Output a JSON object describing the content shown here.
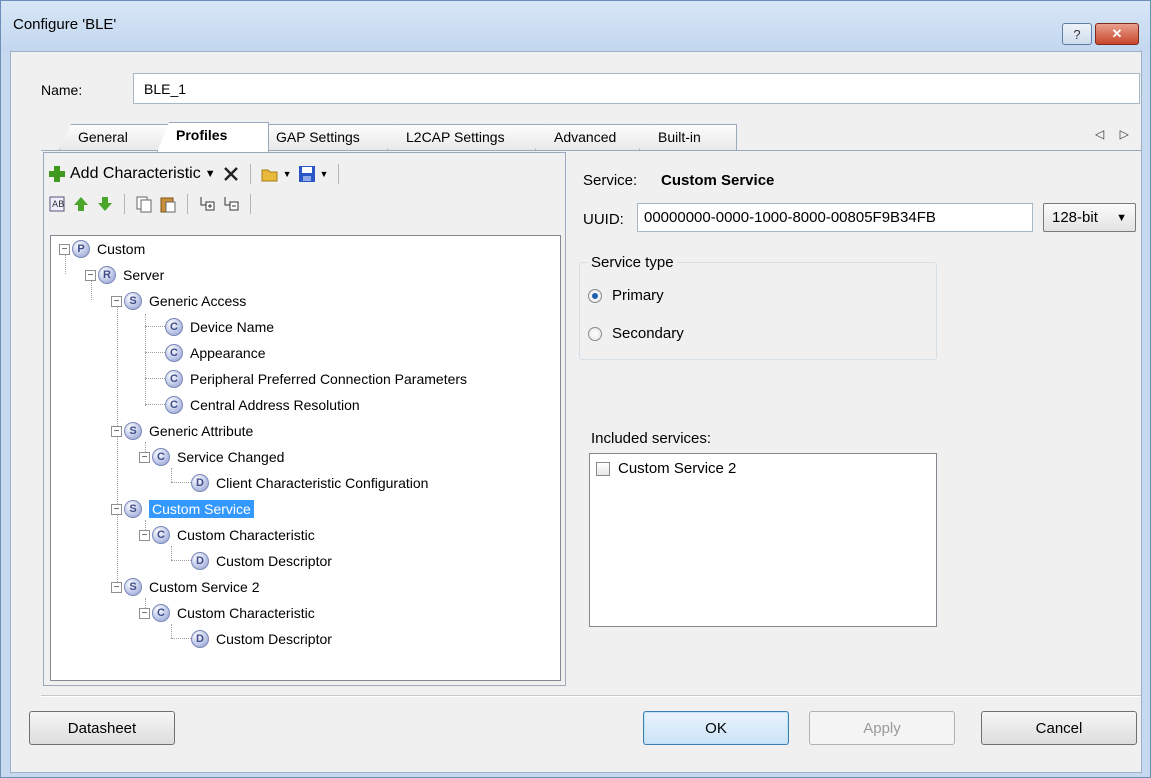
{
  "window": {
    "title": "Configure 'BLE'",
    "help_label": "?",
    "close_label": "✕"
  },
  "name": {
    "label": "Name:",
    "value": "BLE_1"
  },
  "tabs": [
    {
      "label": "General",
      "active": false
    },
    {
      "label": "Profiles",
      "active": true
    },
    {
      "label": "GAP Settings",
      "active": false
    },
    {
      "label": "L2CAP Settings",
      "active": false
    },
    {
      "label": "Advanced",
      "active": false
    },
    {
      "label": "Built-in",
      "active": false
    }
  ],
  "tab_scroll": "◁ ▷",
  "toolbar": {
    "add_characteristic_label": "Add Characteristic",
    "icons": [
      "add-icon",
      "dropdown-arrow-icon",
      "delete-icon",
      "open-folder-icon",
      "save-icon",
      "sort-icon",
      "move-up-icon",
      "move-down-icon",
      "copy-icon",
      "paste-icon",
      "expand-all-icon",
      "collapse-all-icon"
    ]
  },
  "tree": [
    {
      "badge": "P",
      "label": "Custom"
    },
    {
      "badge": "R",
      "label": "Server"
    },
    {
      "badge": "S",
      "label": "Generic Access"
    },
    {
      "badge": "C",
      "label": "Device Name"
    },
    {
      "badge": "C",
      "label": "Appearance"
    },
    {
      "badge": "C",
      "label": "Peripheral Preferred Connection Parameters"
    },
    {
      "badge": "C",
      "label": "Central Address Resolution"
    },
    {
      "badge": "S",
      "label": "Generic Attribute"
    },
    {
      "badge": "C",
      "label": "Service Changed"
    },
    {
      "badge": "D",
      "label": "Client Characteristic Configuration"
    },
    {
      "badge": "S",
      "label": "Custom Service",
      "selected": true
    },
    {
      "badge": "C",
      "label": "Custom Characteristic"
    },
    {
      "badge": "D",
      "label": "Custom Descriptor"
    },
    {
      "badge": "S",
      "label": "Custom Service 2"
    },
    {
      "badge": "C",
      "label": "Custom Characteristic"
    },
    {
      "badge": "D",
      "label": "Custom Descriptor"
    }
  ],
  "service": {
    "label": "Service:",
    "name": "Custom Service",
    "uuid_label": "UUID:",
    "uuid": "00000000-0000-1000-8000-00805F9B34FB",
    "uuid_size": "128-bit",
    "type_legend": "Service type",
    "primary_label": "Primary",
    "secondary_label": "Secondary",
    "selected_type": "Primary",
    "included_label": "Included services:",
    "included": [
      {
        "label": "Custom Service 2",
        "checked": false
      }
    ]
  },
  "buttons": {
    "datasheet": "Datasheet",
    "ok": "OK",
    "apply": "Apply",
    "cancel": "Cancel"
  },
  "colors": {
    "selection": "#3399ff",
    "frame": "#c6d9ef",
    "close": "#c7462b"
  }
}
